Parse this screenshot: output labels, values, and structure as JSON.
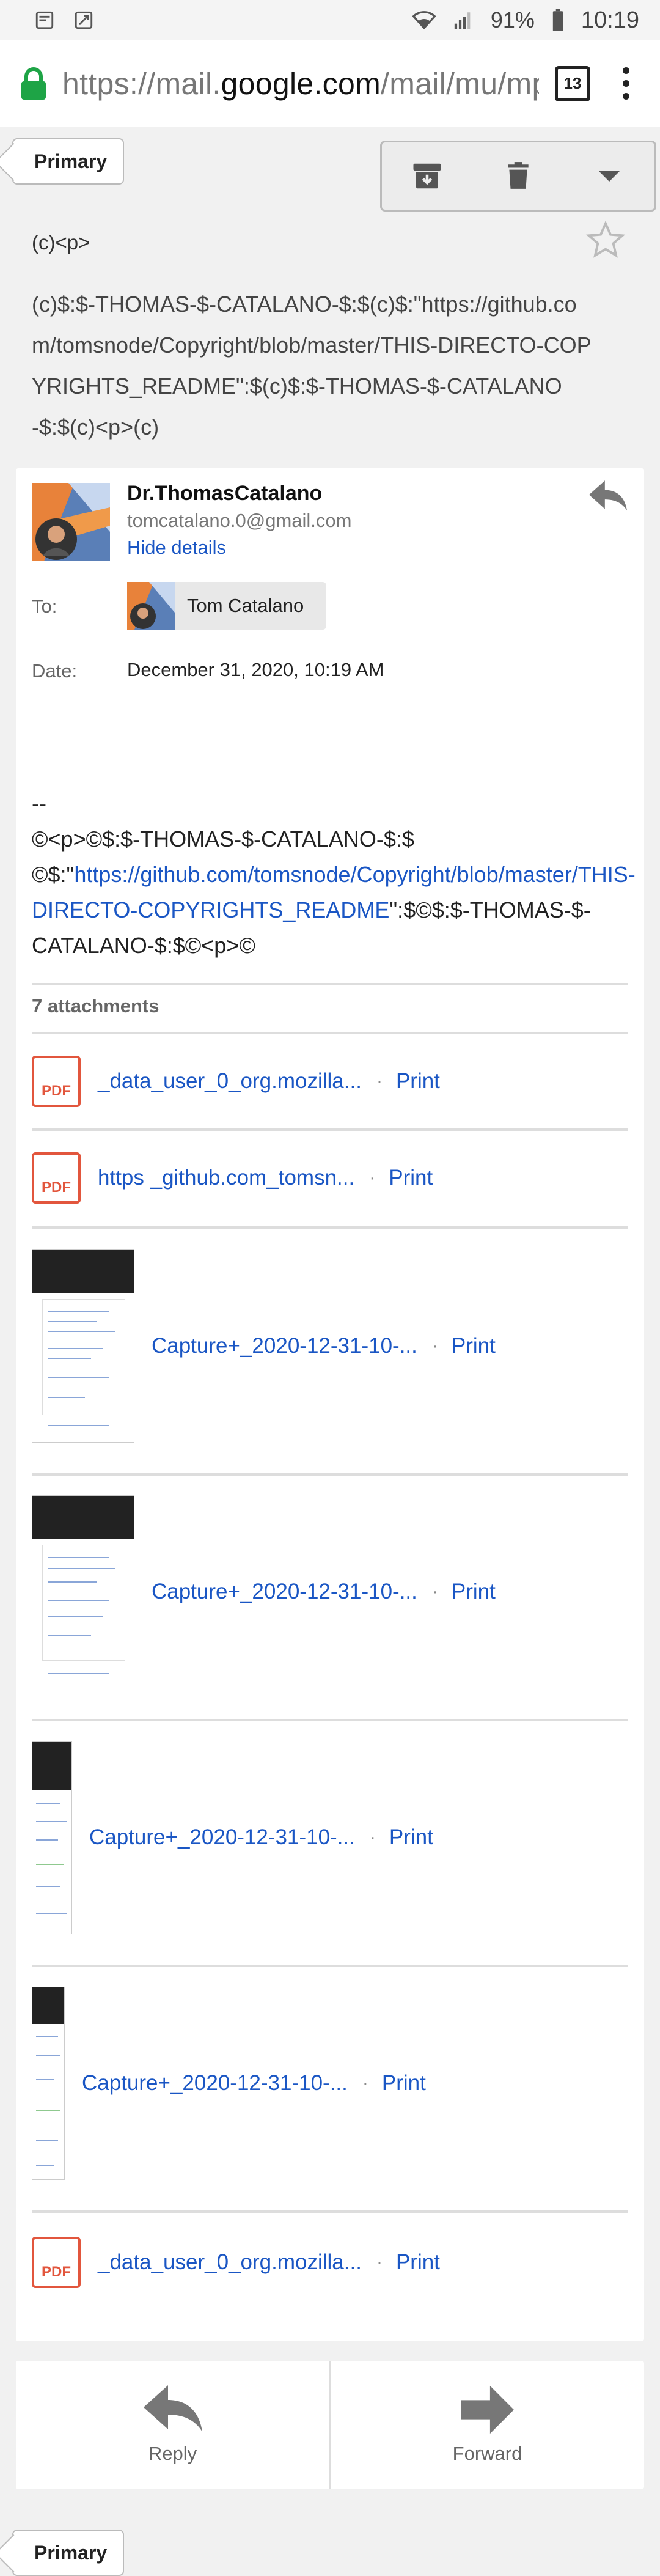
{
  "status_bar": {
    "battery_percent": "91%",
    "time": "10:19",
    "icons": [
      "image-icon",
      "screenshot-icon",
      "wifi-icon",
      "signal-icon",
      "battery-icon"
    ]
  },
  "browser": {
    "url_prefix": "https://mail.",
    "url_domain": "google.com",
    "url_suffix": "/mail/mu/mp",
    "tab_count": "13"
  },
  "label_top": "Primary",
  "label_bottom": "Primary",
  "toolbar": {
    "icons": [
      "archive-icon",
      "delete-icon",
      "more-dropdown-icon"
    ]
  },
  "subject_short": "(c)<p>",
  "subject_long": "(c)$:$-THOMAS-$-CATALANO-$:$(c)$:\"https://github.com/tomsnode/Copyright/blob/master/THIS-DIRECTO-COPYRIGHTS_README\":$(c)$:$-THOMAS-$-CATALANO-$:$(c)<p>(c)",
  "message": {
    "sender_name": "Dr.ThomasCatalano",
    "sender_email": "tomcatalano.0@gmail.com",
    "hide_details": "Hide details",
    "to_label": "To:",
    "to_name": "Tom Catalano",
    "date_label": "Date:",
    "date_value": "December 31, 2020, 10:19 AM",
    "body_dash": "--",
    "body_line1": "©<p>©$:$-THOMAS-$-CATALANO-$:$",
    "body_pre_link": "©$:\"",
    "body_link": "https://github.com/tomsnode/Copyright/blob/master/THIS-DIRECTO-COPYRIGHTS_README",
    "body_post_link": "\":$©$:$-THOMAS-$-CATALANO-$:$©<p>©"
  },
  "attachments": {
    "count_label": "7 attachments",
    "print_label": "Print",
    "items": [
      {
        "name": "_data_user_0_org.mozilla...",
        "kind": "pdf"
      },
      {
        "name": "https _github.com_tomsn...",
        "kind": "pdf"
      },
      {
        "name": "Capture+_2020-12-31-10-...",
        "kind": "image"
      },
      {
        "name": "Capture+_2020-12-31-10-...",
        "kind": "image"
      },
      {
        "name": "Capture+_2020-12-31-10-...",
        "kind": "image"
      },
      {
        "name": "Capture+_2020-12-31-10-...",
        "kind": "image"
      },
      {
        "name": "_data_user_0_org.mozilla...",
        "kind": "pdf"
      }
    ],
    "pdf_badge": "PDF"
  },
  "actions": {
    "reply": "Reply",
    "forward": "Forward"
  }
}
